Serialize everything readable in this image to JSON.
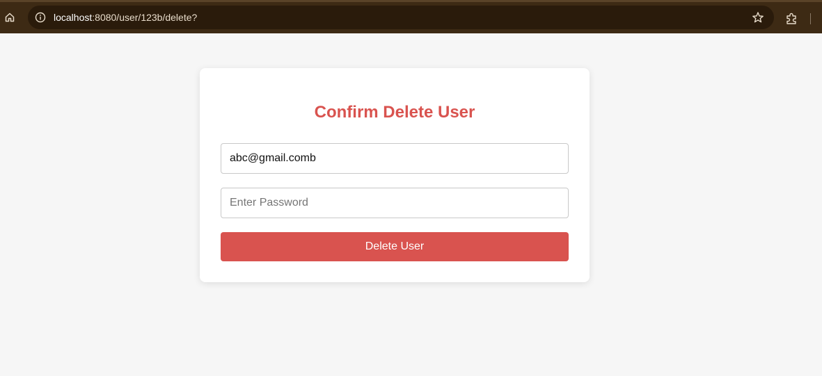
{
  "browser": {
    "url_host": "localhost",
    "url_path": ":8080/user/123b/delete?",
    "icons": [
      "home-icon",
      "info-icon",
      "star-icon",
      "extensions-icon"
    ]
  },
  "form": {
    "title": "Confirm Delete User",
    "email_value": "abc@gmail.comb",
    "password_placeholder": "Enter Password",
    "submit_label": "Delete User"
  },
  "colors": {
    "accent": "#d9534f",
    "toolbar": "#3d2a14",
    "background": "#f6f6f6"
  }
}
